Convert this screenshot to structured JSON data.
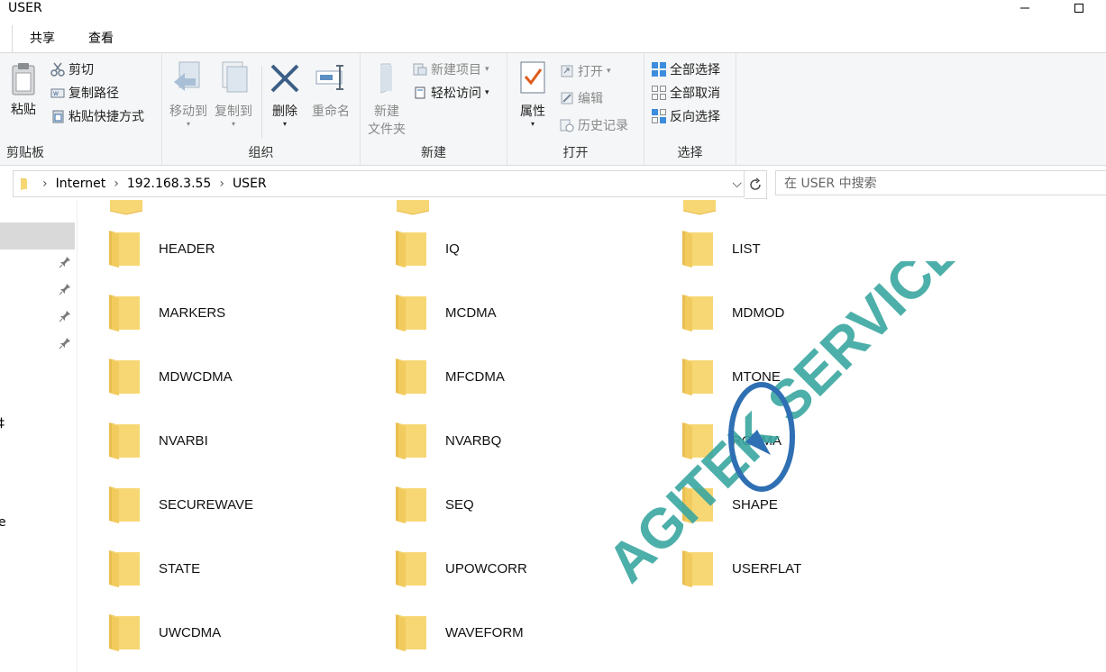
{
  "window": {
    "title": "USER"
  },
  "tabs": [
    "共享",
    "查看"
  ],
  "ribbon": {
    "clipboard": {
      "label": "剪贴板",
      "paste": "粘贴",
      "cut": "剪切",
      "copy_path": "复制路径",
      "paste_shortcut": "粘贴快捷方式"
    },
    "organize": {
      "label": "组织",
      "move_to": "移动到",
      "copy_to": "复制到",
      "delete": "删除",
      "rename": "重命名"
    },
    "new": {
      "label": "新建",
      "new_folder_line1": "新建",
      "new_folder_line2": "文件夹",
      "new_item": "新建项目",
      "easy_access": "轻松访问"
    },
    "open": {
      "label": "打开",
      "properties": "属性",
      "open": "打开",
      "edit": "编辑",
      "history": "历史记录"
    },
    "select": {
      "label": "选择",
      "select_all": "全部选择",
      "select_none": "全部取消",
      "invert": "反向选择"
    }
  },
  "address": {
    "crumbs": [
      "Internet",
      "192.168.3.55",
      "USER"
    ]
  },
  "search": {
    "placeholder": "在 USER 中搜索"
  },
  "nav": {
    "fragments": [
      "‡",
      "e"
    ]
  },
  "folders": [
    "HEADER",
    "IQ",
    "LIST",
    "MARKERS",
    "MCDMA",
    "MDMOD",
    "MDWCDMA",
    "MFCDMA",
    "MTONE",
    "NVARBI",
    "NVARBQ",
    "RCDMA",
    "SECUREWAVE",
    "SEQ",
    "SHAPE",
    "STATE",
    "UPOWCORR",
    "USERFLAT",
    "UWCDMA",
    "WAVEFORM"
  ],
  "watermark": {
    "text": "AGITEK SERVICE",
    "color": "#3aa6a0"
  },
  "colors": {
    "folder": "#f7d774",
    "folder_dark": "#e8b94a",
    "selected_nav": "#d9d9d9"
  }
}
